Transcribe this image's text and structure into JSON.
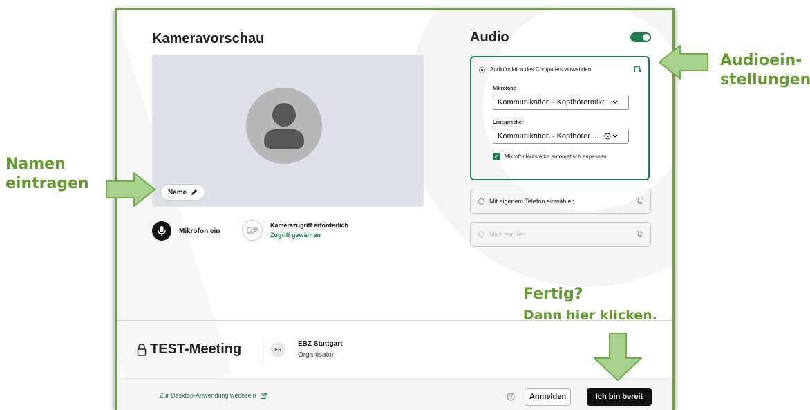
{
  "annotations": {
    "name_hint": [
      "Namen",
      "eintragen"
    ],
    "audio_hint": [
      "Audioein-",
      "stellungen"
    ],
    "done_hint": [
      "Fertig?",
      "Dann hier klicken."
    ]
  },
  "preview": {
    "title": "Kameravorschau",
    "name_pill": "Name",
    "mic_label": "Mikrofon ein",
    "camera_label": "Kamerazugriff erforderlich",
    "camera_link": "Zugriff gewähren"
  },
  "audio": {
    "title": "Audio",
    "toggle_on": true,
    "computer_audio_label": "Audiofunktion des Computers verwenden",
    "mic_heading": "Mikrofone",
    "mic_value": "Kommunikation - Kopfhörermikr...",
    "speaker_heading": "Lautsprecher",
    "speaker_value": "Kommunikation - Kopfhörer ...",
    "auto_gain_label": "Mikrofonlautstärke automatisch anpassen",
    "phone_dialin_label": "Mit eigenem Telefon einwählen",
    "callme_label": "Mich anrufen"
  },
  "meeting": {
    "title": "TEST-Meeting",
    "organizer_initials": "ES",
    "organizer_name": "EBZ Stuttgart",
    "organizer_role": "Organisator"
  },
  "footer": {
    "desktop_link": "Zur Desktop-Anwendung wechseln",
    "signin_button": "Anmelden",
    "ready_button": "Ich bin bereit"
  },
  "colors": {
    "accent_green": "#1b7e4e",
    "annotation_green": "#639a30",
    "arrow_fill": "#a9d18e"
  }
}
